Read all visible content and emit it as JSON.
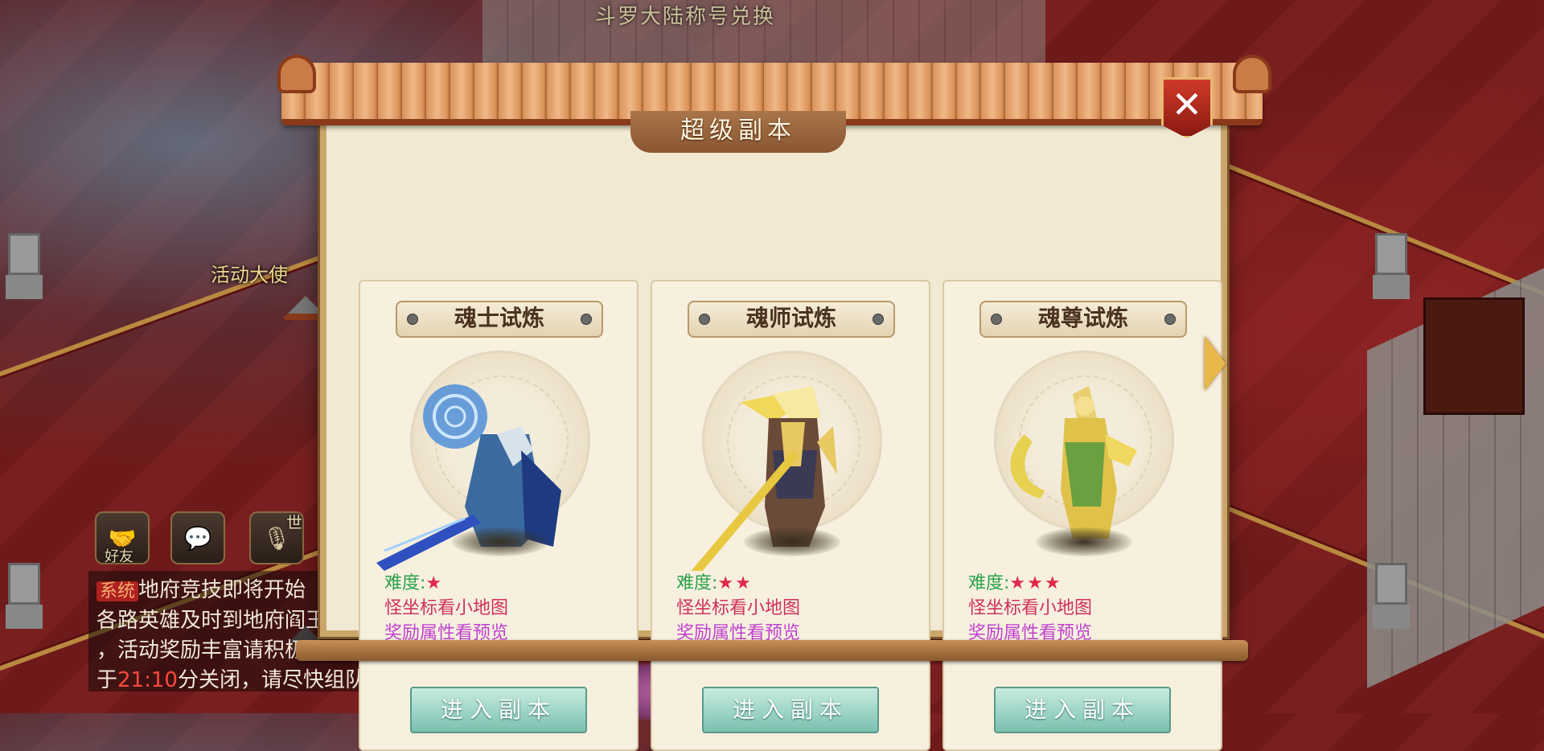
{
  "background": {
    "top_banner": "斗罗大陆称号兑换",
    "npc_label": "活动大使"
  },
  "hud": {
    "friends_label": "好友",
    "world_badge": "世"
  },
  "chat": {
    "tag": "系统",
    "line1": "地府竞技即将开始",
    "line2": "各路英雄及时到地府阎王",
    "line3": "，活动奖励丰富请积极",
    "line4_pre": "于",
    "line4_time": "21:10",
    "line4_post": "分关闭，请尽快组队参与。"
  },
  "panel": {
    "title": "超级副本",
    "close_label": "✕",
    "cards": [
      {
        "name": "魂士试炼",
        "diff_label": "难度:",
        "stars": "★",
        "tip1": "怪坐标看小地图",
        "tip2": "奖励属性看预览",
        "button": "进入副本"
      },
      {
        "name": "魂师试炼",
        "diff_label": "难度:",
        "stars": "★★",
        "tip1": "怪坐标看小地图",
        "tip2": "奖励属性看预览",
        "button": "进入副本"
      },
      {
        "name": "魂尊试炼",
        "diff_label": "难度:",
        "stars": "★★★",
        "tip1": "怪坐标看小地图",
        "tip2": "奖励属性看预览",
        "button": "进入副本"
      }
    ]
  },
  "colors": {
    "difficulty": "#2aa24a",
    "star": "#e0284a",
    "tip_map": "#d0305a",
    "tip_reward": "#c040d0",
    "button": "#7ac0b0"
  }
}
